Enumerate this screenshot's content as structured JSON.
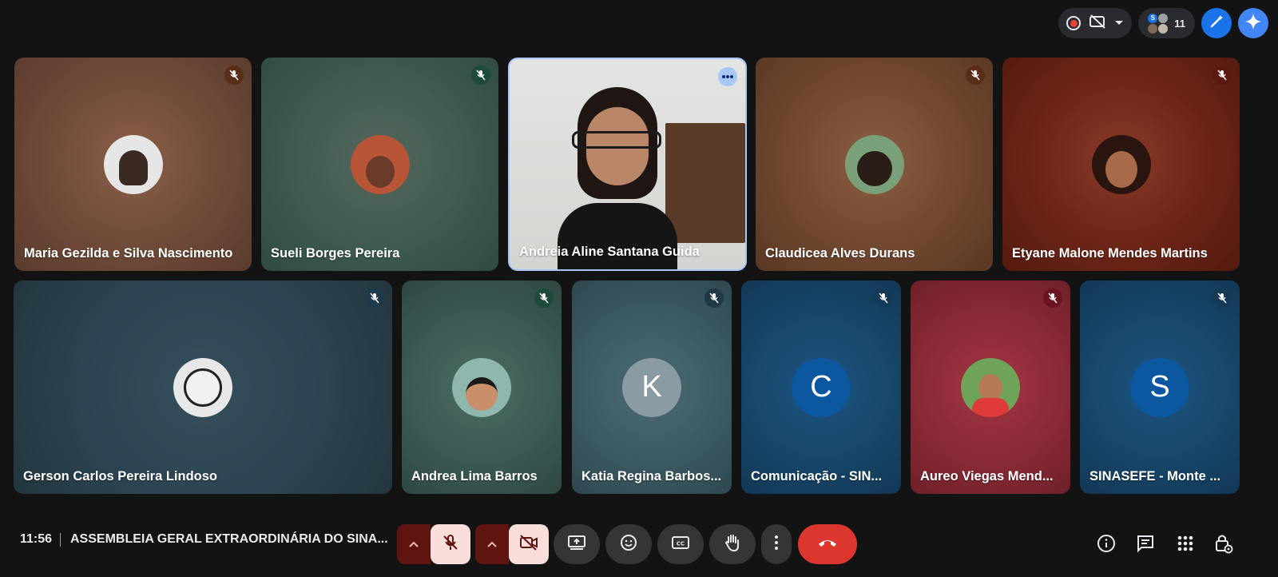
{
  "topbar": {
    "recording_icon": "recording-dot-icon",
    "captions_off_icon": "captions-off-icon",
    "dropdown_icon": "chevron-down-icon",
    "participant_count": "11",
    "mini_avatar_letter": "S"
  },
  "tiles_row1": [
    {
      "name": "Maria Gezilda e Silva Nascimento",
      "bg": "#6e4a38"
    },
    {
      "name": "Sueli Borges Pereira",
      "bg": "#3e5a50"
    },
    {
      "name": "Andreia Aline Santana Guida",
      "bg": "#d9d9d6"
    },
    {
      "name": "Claudicea Alves Durans",
      "bg": "#70472f"
    },
    {
      "name": "Etyane Malone Mendes Martins",
      "bg": "#6b2417"
    }
  ],
  "tiles_row2": [
    {
      "name": "Gerson Carlos Pereira Lindoso",
      "bg": "#2c4451"
    },
    {
      "name": "Andrea Lima Barros",
      "bg": "#3b5a54"
    },
    {
      "name": "Katia Regina Barbos...",
      "letter": "K",
      "bg": "#3c5a62"
    },
    {
      "name": "Comunicação - SIN...",
      "letter": "C",
      "bg": "#17466a"
    },
    {
      "name": "Aureo Viegas Mend...",
      "bg": "#8a2a36"
    },
    {
      "name": "SINASEFE - Monte ...",
      "letter": "S",
      "bg": "#17466a"
    }
  ],
  "bottom": {
    "time": "11:56",
    "meeting_title": "ASSEMBLEIA GERAL EXTRAORDINÁRIA DO SINA...",
    "controls": [
      "mic-off-icon",
      "camera-off-icon",
      "present-screen-icon",
      "emoji-icon",
      "captions-icon",
      "raise-hand-icon",
      "more-options-icon",
      "end-call-icon"
    ],
    "right_controls": [
      "info-icon",
      "chat-icon",
      "activities-icon",
      "host-controls-icon"
    ]
  },
  "colors": {
    "background": "#131314",
    "end_call": "#dc362e",
    "muted_button": "#f9dedc",
    "active_speaker_border": "#a8c7fa"
  }
}
